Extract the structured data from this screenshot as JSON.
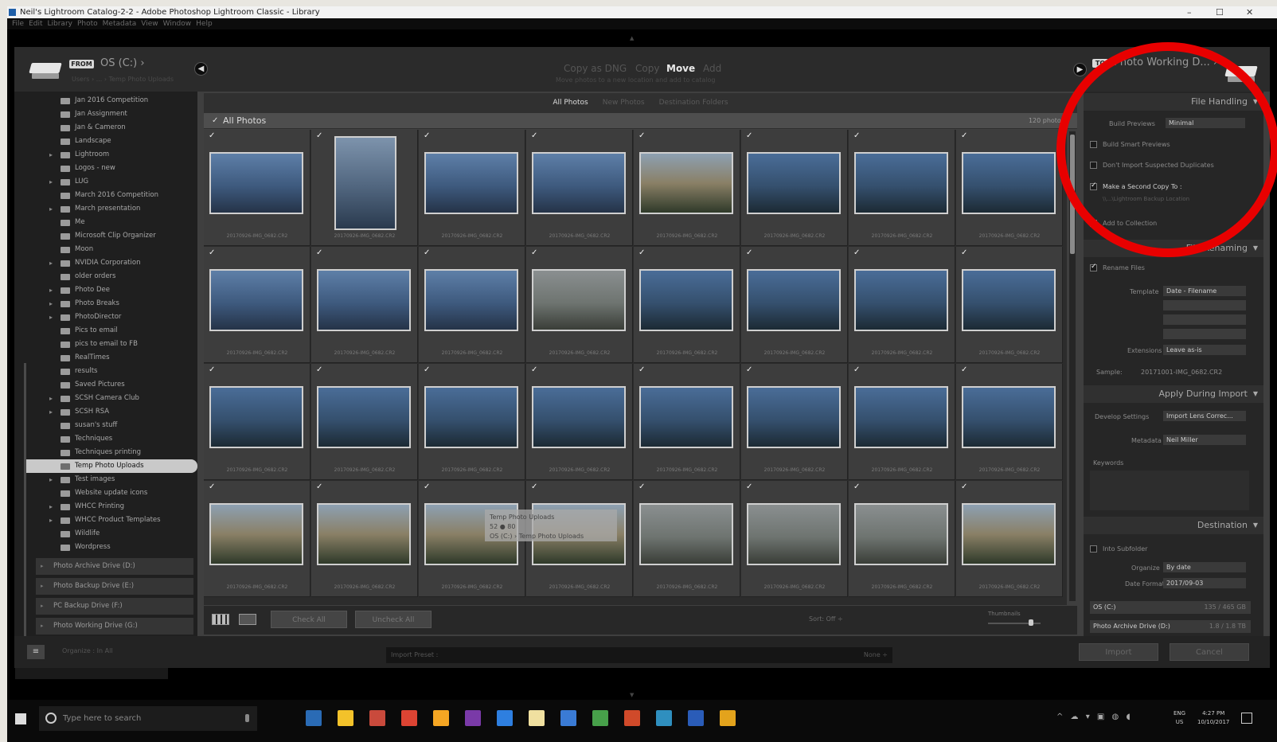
{
  "window": {
    "title": "Neil's Lightroom Catalog-2-2 - Adobe Photoshop Lightroom Classic - Library",
    "minimize": "–",
    "maximize": "☐",
    "close": "✕"
  },
  "menu": [
    "File",
    "Edit",
    "Library",
    "Photo",
    "Metadata",
    "View",
    "Window",
    "Help"
  ],
  "header": {
    "from_badge": "FROM",
    "source_title": "OS (C:) ›",
    "source_sub": "Users › ... › Temp Photo Uploads",
    "modes": [
      "Copy as DNG",
      "Copy",
      "Move",
      "Add"
    ],
    "active_mode": "Move",
    "mode_sub": "Move photos to a new location and add to catalog",
    "to_badge": "TO",
    "dest_title": "Photo Working D... ›",
    "back_arrow": "◀",
    "forward_arrow": "▶"
  },
  "source_folders": [
    {
      "label": "Jan 2016 Competition",
      "expand": ""
    },
    {
      "label": "Jan Assignment",
      "expand": ""
    },
    {
      "label": "Jan & Cameron",
      "expand": ""
    },
    {
      "label": "Landscape",
      "expand": ""
    },
    {
      "label": "Lightroom",
      "expand": "▸"
    },
    {
      "label": "Logos - new",
      "expand": ""
    },
    {
      "label": "LUG",
      "expand": "▸"
    },
    {
      "label": "March 2016 Competition",
      "expand": ""
    },
    {
      "label": "March presentation",
      "expand": "▸"
    },
    {
      "label": "Me",
      "expand": ""
    },
    {
      "label": "Microsoft Clip Organizer",
      "expand": ""
    },
    {
      "label": "Moon",
      "expand": ""
    },
    {
      "label": "NVIDIA Corporation",
      "expand": "▸"
    },
    {
      "label": "older orders",
      "expand": ""
    },
    {
      "label": "Photo Dee",
      "expand": "▸"
    },
    {
      "label": "Photo Breaks",
      "expand": "▸"
    },
    {
      "label": "PhotoDirector",
      "expand": "▸"
    },
    {
      "label": "Pics to email",
      "expand": ""
    },
    {
      "label": "pics to email to FB",
      "expand": ""
    },
    {
      "label": "RealTimes",
      "expand": ""
    },
    {
      "label": "results",
      "expand": ""
    },
    {
      "label": "Saved Pictures",
      "expand": ""
    },
    {
      "label": "SCSH Camera Club",
      "expand": "▸"
    },
    {
      "label": "SCSH RSA",
      "expand": "▸"
    },
    {
      "label": "susan's stuff",
      "expand": ""
    },
    {
      "label": "Techniques",
      "expand": ""
    },
    {
      "label": "Techniques printing",
      "expand": ""
    },
    {
      "label": "Temp Photo Uploads",
      "expand": "",
      "selected": true
    },
    {
      "label": "Test images",
      "expand": "▸"
    },
    {
      "label": "Website update icons",
      "expand": ""
    },
    {
      "label": "WHCC Printing",
      "expand": "▸"
    },
    {
      "label": "WHCC Product Templates",
      "expand": "▸"
    },
    {
      "label": "Wildlife",
      "expand": ""
    },
    {
      "label": "Wordpress",
      "expand": ""
    }
  ],
  "drives": [
    {
      "label": "Photo Archive Drive (D:)"
    },
    {
      "label": "Photo Backup Drive (E:)"
    },
    {
      "label": "PC Backup Drive (F:)"
    },
    {
      "label": "Photo Working Drive (G:)"
    }
  ],
  "grid_tabs": [
    "All Photos",
    "New Photos",
    "Destination Folders"
  ],
  "grid_tab_active": "All Photos",
  "all_photos_label": "All Photos",
  "photo_count": "120 photos",
  "check": "✓",
  "photo_filename": "20170926-IMG_0682.CR2",
  "thumb_styles": [
    "",
    "portrait",
    "",
    "",
    "warm",
    "dark",
    "dark",
    "dark",
    "",
    "",
    "",
    "fog",
    "dark",
    "dark",
    "dark",
    "dark",
    "dark",
    "dark",
    "dark",
    "dark",
    "dark",
    "dark",
    "dark",
    "dark",
    "warm",
    "warm",
    "warm",
    "warm",
    "fog",
    "fog",
    "fog",
    "warm"
  ],
  "tooltip": {
    "line1": "Temp Photo Uploads",
    "line2": "52 ● 80",
    "line3": "OS (C:) › Temp Photo Uploads"
  },
  "grid_toolbar": {
    "check_all": "Check All",
    "uncheck_all": "Uncheck All",
    "sort": "Sort:  Off ÷",
    "thumbnails": "Thumbnails"
  },
  "right_panel": {
    "file_handling": "File Handling",
    "build_previews_label": "Build Previews",
    "build_previews_value": "Minimal",
    "smart_previews": "Build Smart Previews",
    "dont_import_dupes": "Don't Import Suspected Duplicates",
    "second_copy": "Make a Second Copy To :",
    "second_copy_path": "\\\\...\\Lightroom Backup Location",
    "add_collection": "Add to Collection",
    "file_renaming": "File Renaming",
    "rename_files": "Rename Files",
    "template_label": "Template",
    "template_value": "Date - Filename",
    "extensions_label": "Extensions",
    "extensions_value": "Leave as-is",
    "sample_label": "Sample:",
    "sample_value": "20171001-IMG_0682.CR2",
    "apply_during_import": "Apply During Import",
    "develop_settings_label": "Develop Settings",
    "develop_settings_value": "Import Lens Correc...",
    "metadata_label": "Metadata",
    "metadata_value": "Neil Miller",
    "keywords_label": "Keywords",
    "destination": "Destination",
    "into_subfolder": "Into Subfolder",
    "organize_label": "Organize",
    "organize_value": "By date",
    "date_format_label": "Date Format",
    "date_format_value": "2017/09-03",
    "dest_drive_1": "OS (C:)",
    "dest_drive_1_space": "135 / 465 GB",
    "dest_drive_2": "Photo Archive Drive (D:)",
    "dest_drive_2_space": "1.8 / 1.8 TB"
  },
  "footer": {
    "preset_icon": "≡",
    "copy_photos": "Organize : In All",
    "import_preset": "Import Preset :",
    "none": "None ÷",
    "import": "Import",
    "cancel": "Cancel"
  },
  "taskbar": {
    "search_placeholder": "Type here to search",
    "tray": "^ ☁ ▾ ▣ ◍ ◖",
    "lang1": "ENG",
    "lang2": "US",
    "time": "4:27 PM",
    "date": "10/10/2017"
  },
  "taskbar_apps": [
    "#2a6bb5",
    "#f3c22a",
    "#c94a3c",
    "#dd4433",
    "#f5a623",
    "#7a3aa8",
    "#2e7fe0",
    "#f0e0a0",
    "#3a7bd5",
    "#47a04a",
    "#d04a2a",
    "#2f8fbf",
    "#2a5cb8",
    "#e3a31c"
  ],
  "colors": {
    "annotation": "#e80000",
    "accent": "#d8d8d8"
  }
}
